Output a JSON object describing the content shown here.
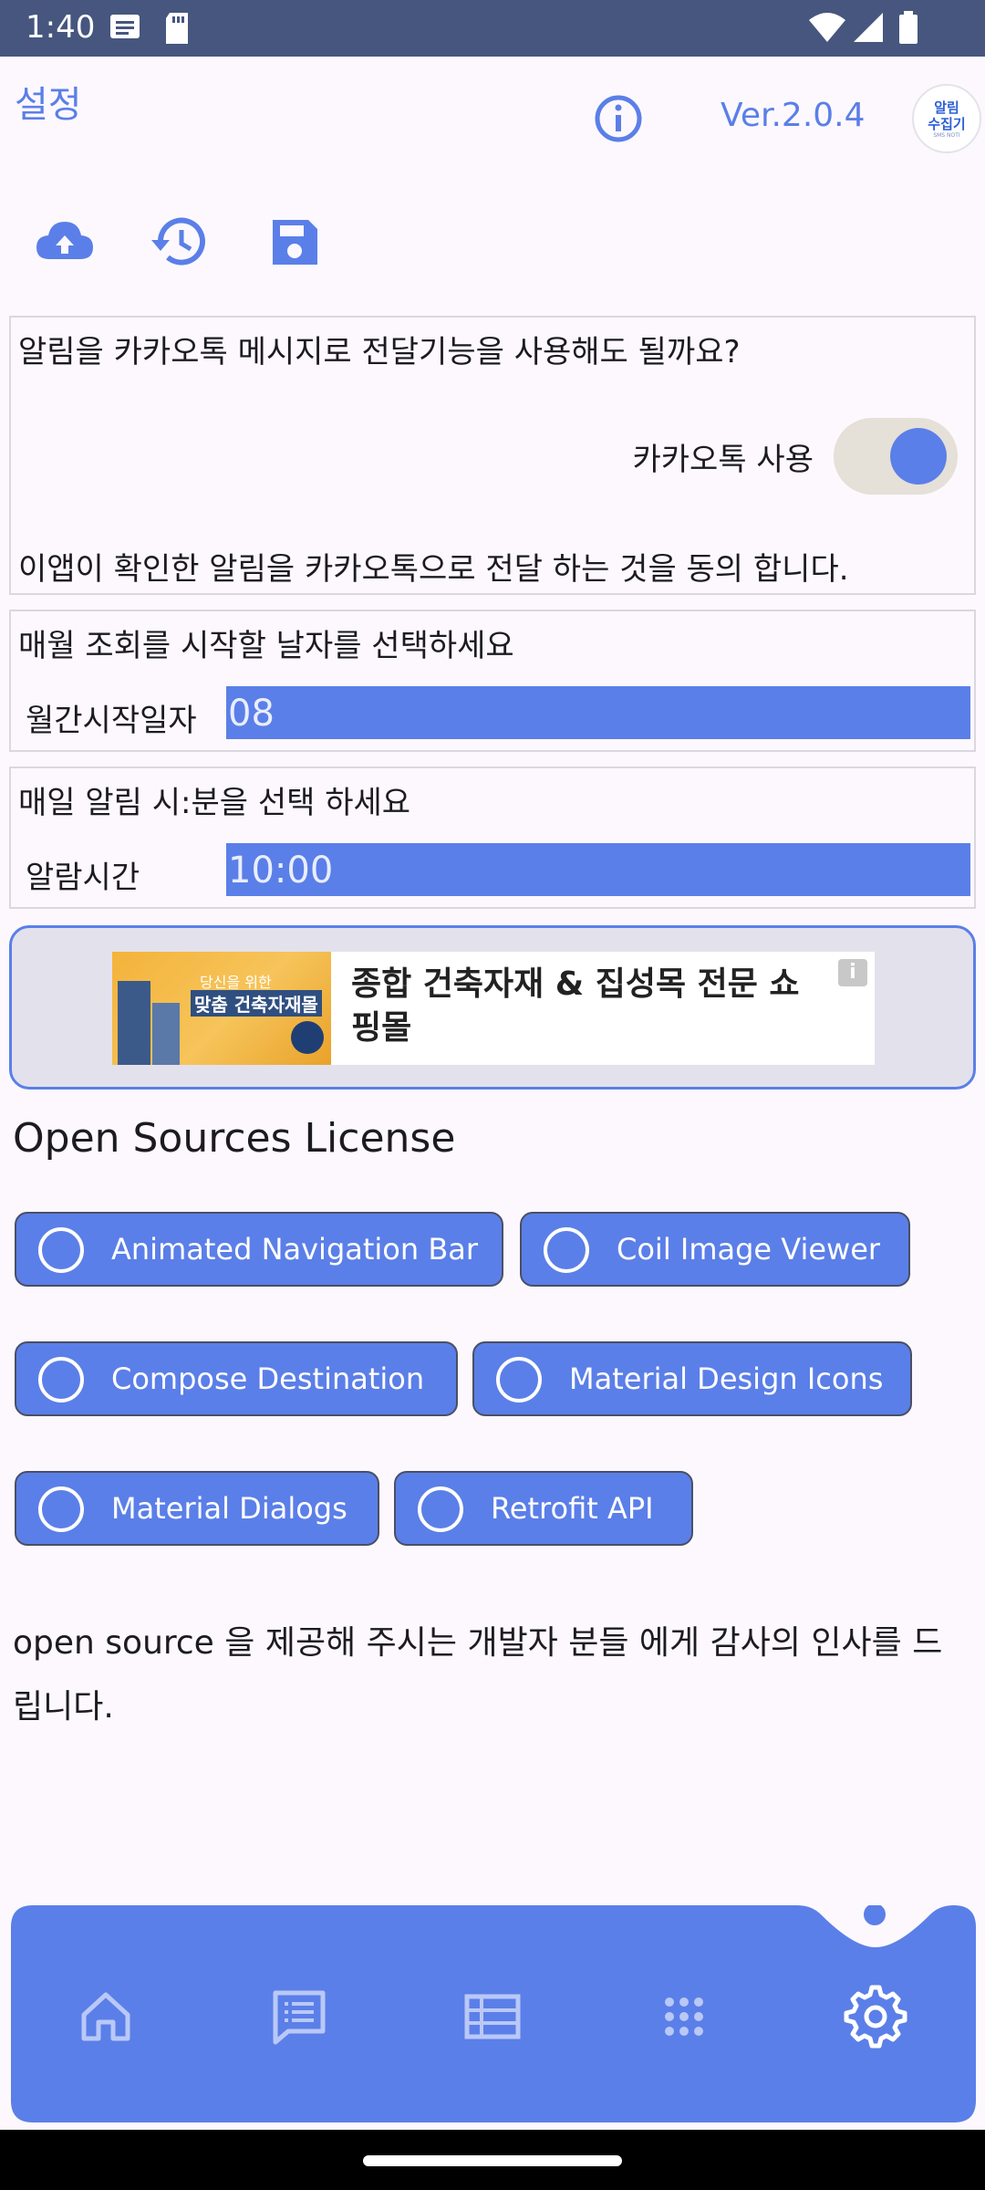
{
  "status_bar": {
    "time": "1:40"
  },
  "header": {
    "title": "설정",
    "version": "Ver.2.0.4",
    "logo_text_1": "알림",
    "logo_text_2": "수집기",
    "logo_sub": "SMS NOTI"
  },
  "kakao_card": {
    "question": "알림을 카카오톡 메시지로 전달기능을 사용해도 될까요?",
    "toggle_label": "카카오톡 사용",
    "toggle_on": true,
    "consent": "이앱이 확인한 알림을 카카오톡으로 전달 하는 것을 동의 합니다."
  },
  "month_card": {
    "prompt": "매월 조회를 시작할 날자를 선택하세요",
    "label": "월간시작일자",
    "value": "08"
  },
  "alarm_card": {
    "prompt": "매일 알림 시:분을 선택 하세요",
    "label": "알람시간",
    "value": "10:00"
  },
  "ad": {
    "image_sub": "당신을 위한",
    "image_main": "맞춤 건축자재몰",
    "headline": "종합 건축자재 & 집성목 전문 쇼핑몰",
    "info_glyph": "i"
  },
  "licenses": {
    "title": "Open Sources License",
    "items": [
      {
        "label": "Animated Navigation Bar"
      },
      {
        "label": "Coil Image Viewer"
      },
      {
        "label": "Compose Destination"
      },
      {
        "label": "Material Design Icons"
      },
      {
        "label": "Material Dialogs"
      },
      {
        "label": "Retrofit API"
      }
    ]
  },
  "thanks": "open source 을 제공해 주시는 개발자 분들 에게 감사의 인사를 드립니다.",
  "bottom_nav": {
    "items": [
      {
        "icon": "home-icon"
      },
      {
        "icon": "message-icon"
      },
      {
        "icon": "table-icon"
      },
      {
        "icon": "apps-grid-icon"
      },
      {
        "icon": "settings-icon",
        "selected": true
      }
    ]
  },
  "colors": {
    "accent": "#5B7FE8",
    "status_bar": "#46567F",
    "background": "#FCF8FD"
  }
}
